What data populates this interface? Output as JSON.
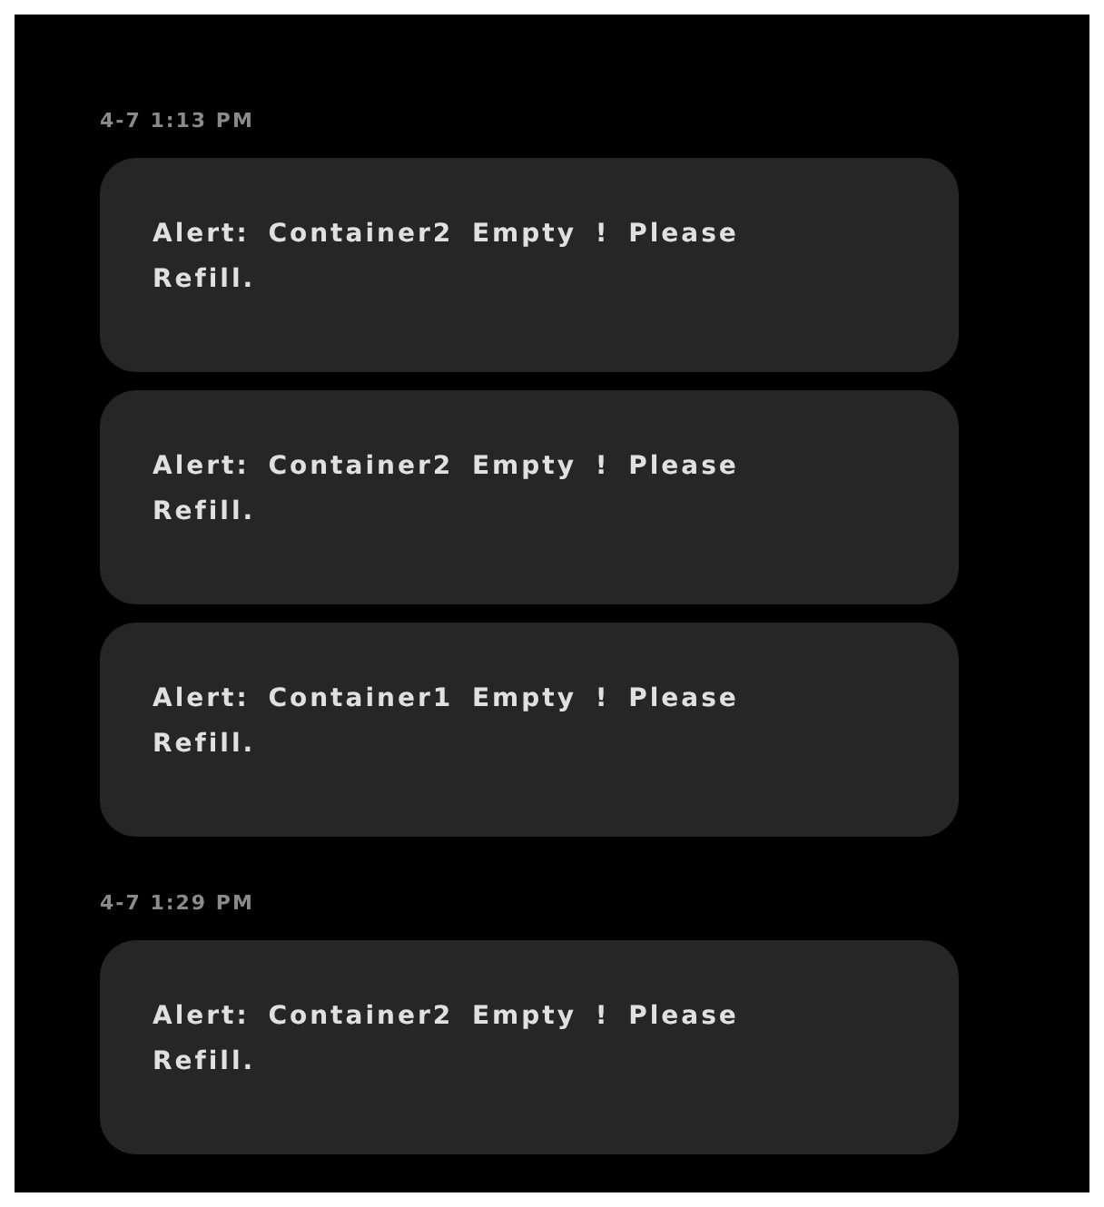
{
  "groups": [
    {
      "time": "4-7 1:13 PM",
      "alerts": [
        {
          "text": "Alert: Container2 Empty ! Please Refill."
        },
        {
          "text": "Alert: Container2 Empty ! Please Refill."
        },
        {
          "text": "Alert: Container1 Empty ! Please Refill."
        }
      ]
    },
    {
      "time": "4-7 1:29 PM",
      "alerts": [
        {
          "text": "Alert: Container2 Empty ! Please Refill."
        }
      ]
    }
  ]
}
